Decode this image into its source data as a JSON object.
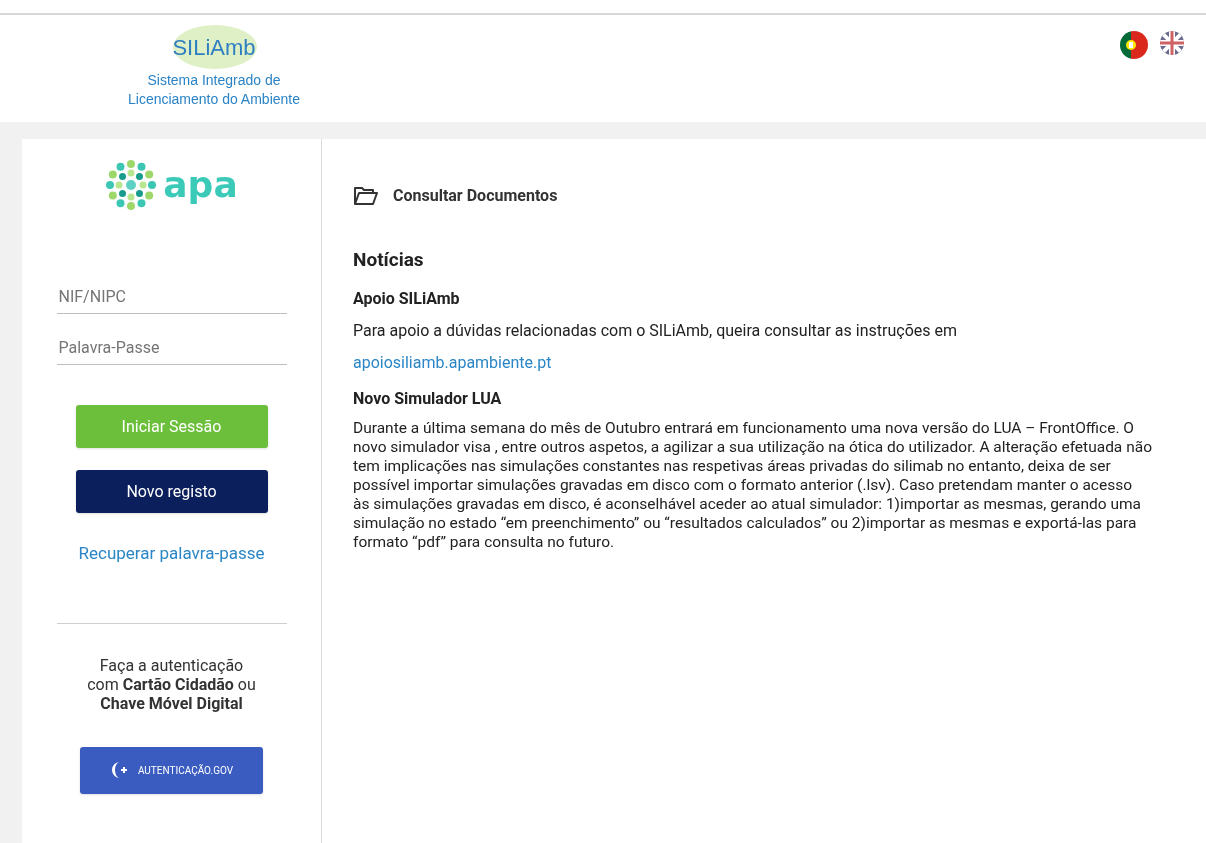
{
  "header": {
    "logo_text": "SILiAmb",
    "logo_subtitle": [
      "Sistema Integrado de",
      "Licenciamento do Ambiente"
    ]
  },
  "languages": [
    {
      "kind": "pt",
      "selected": true
    },
    {
      "kind": "en",
      "selected": false
    }
  ],
  "sidebar": {
    "logo_text": "apa",
    "fields": [
      {
        "placeholder": "NIF/NIPC"
      },
      {
        "placeholder": "Palavra-Passe"
      }
    ],
    "buttons": [
      {
        "label": "Iniciar Sessão",
        "kind": "primary"
      },
      {
        "label": "Novo registo",
        "kind": "secondary"
      }
    ],
    "recover_link": "Recuperar palavra-passe",
    "auth_note": "Faça a autenticação com **Cartão Cidadão** ou **Chave Móvel Digital**",
    "auth_button": "AUTENTICAÇÃO.GOV"
  },
  "main": {
    "documents_link": "Consultar Documentos",
    "news_title": "Notícias",
    "news": [
      {
        "title": "Apoio SILiAmb",
        "paragraphs": [
          "Para apoio a dúvidas relacionadas com o SILiAmb, queira consultar as instruções em"
        ],
        "link": "apoiosiliamb.apambiente.pt"
      },
      {
        "title": "Novo Simulador LUA",
        "paragraphs": [
          "Durante a última semana do mês de Outubro entrará em funcionamento uma nova versão do LUA – FrontOffice. O novo simulador visa , entre outros aspetos, a agilizar a sua utilização na ótica do utilizador. A alteração efetuada não tem implicações nas simulações constantes nas respetivas áreas privadas do silimab no entanto, deixa de ser possível importar simulações gravadas em disco com o formato anterior (.lsv). Caso pretendam manter o acesso às simulações gravadas em disco, é aconselhável aceder ao atual simulador: 1)importar as mesmas, gerando uma simulação no estado “em preenchimento” ou “resultados calculados” ou 2)importar as mesmas e exportá-las para formato “pdf” para consulta no futuro."
        ]
      }
    ]
  }
}
